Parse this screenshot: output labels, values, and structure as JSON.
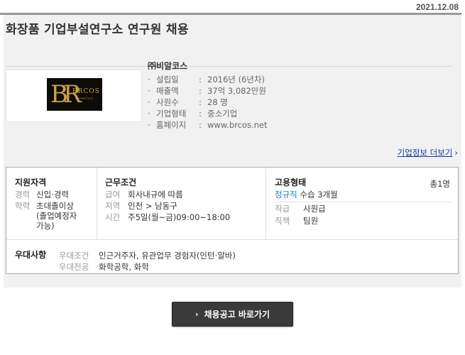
{
  "date": "2021.12.08",
  "title": "화장품 기업부설연구소 연구원 채용",
  "company": {
    "name": "㈜비알코스",
    "logo_text": "BR",
    "logo_name": "BRCOS",
    "logo_sub": "COSMETICS",
    "details": [
      {
        "key": "설립일",
        "value": "2016년 (6년차)"
      },
      {
        "key": "매출액",
        "value": "37억 3,082만원"
      },
      {
        "key": "사원수",
        "value": "28 명"
      },
      {
        "key": "기업형태",
        "value": "중소기업"
      },
      {
        "key": "홈페이지",
        "value": "www.brcos.net"
      }
    ],
    "more_link": "기업정보 더보기"
  },
  "qualification": {
    "heading": "지원자격",
    "career_label": "경력",
    "career_value": "신입·경력",
    "edu_label": "학력",
    "edu_value_1": "초대졸이상",
    "edu_value_2": "(졸업예정자",
    "edu_value_3": "가능)"
  },
  "conditions": {
    "heading": "근무조건",
    "pay_label": "급여",
    "pay_value": "회사내규에 따름",
    "region_label": "지역",
    "region_value": "인천 > 남동구",
    "time_label": "시간",
    "time_value": "주5일(월~금)09:00~18:00"
  },
  "employment": {
    "heading": "고용형태",
    "total": "총1명",
    "type": "정규직",
    "type_note": "수습 3개월",
    "rank_label": "직급",
    "rank_value": "사원급",
    "duty_label": "직책",
    "duty_value": "팀원"
  },
  "preference": {
    "heading": "우대사항",
    "cond_label": "우대조건",
    "cond_value": "인근거주자, 유관업무 경험자(인턴·알바)",
    "major_label": "우대전공",
    "major_value": "화학공학, 화학"
  },
  "cta": "채용공고 바로가기",
  "colors": {
    "link": "#0c3ea6",
    "accent": "#1a7fc1",
    "button": "#3a3a3a"
  }
}
